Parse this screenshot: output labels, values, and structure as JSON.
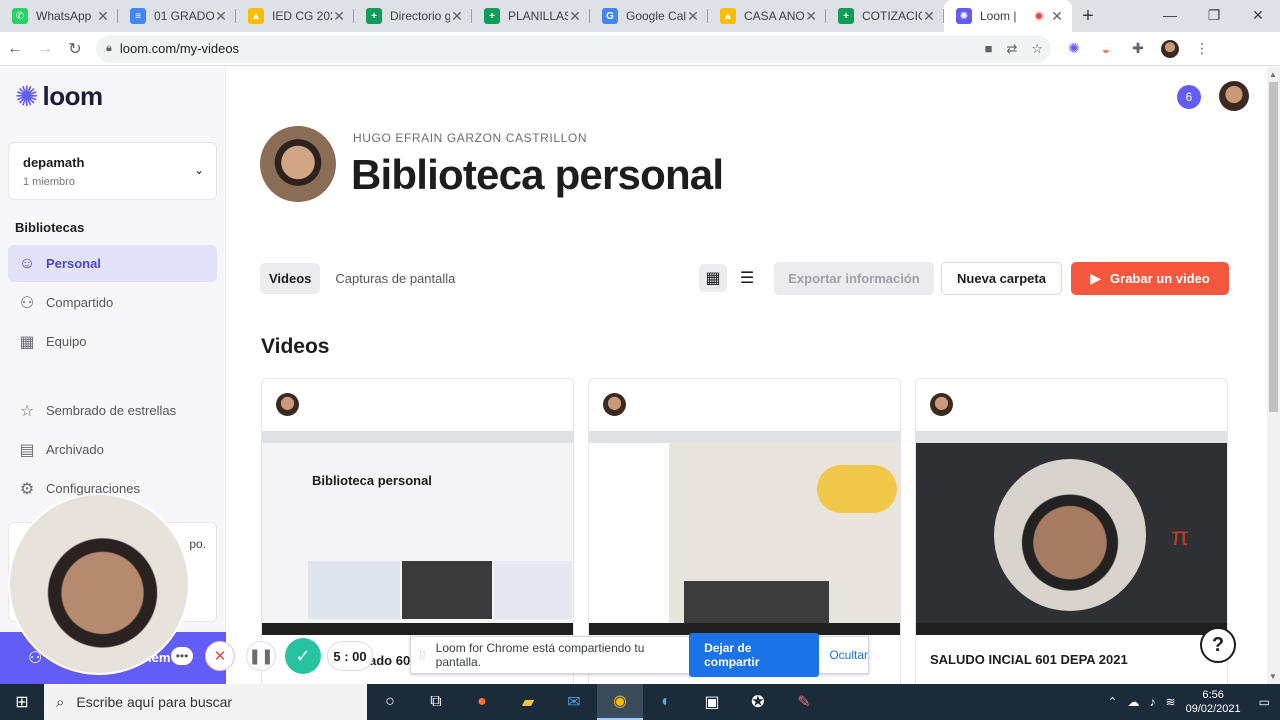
{
  "browser": {
    "tabs": [
      {
        "title": "WhatsApp",
        "color": "#25d366",
        "glyph": "✆"
      },
      {
        "title": "01 GRADO",
        "color": "#4285f4",
        "glyph": "≡"
      },
      {
        "title": "IED CG 202",
        "color": "#fbbc04",
        "glyph": "▲"
      },
      {
        "title": "Directorio g",
        "color": "#0f9d58",
        "glyph": "+"
      },
      {
        "title": "PLANILLAS",
        "color": "#0f9d58",
        "glyph": "+"
      },
      {
        "title": "Google Cal",
        "color": "#4285f4",
        "glyph": "G"
      },
      {
        "title": "CASA ANO",
        "color": "#fbbc04",
        "glyph": "▲"
      },
      {
        "title": "COTIZACIO",
        "color": "#0f9d58",
        "glyph": "+"
      }
    ],
    "active_tab": {
      "title": "Loom |",
      "color": "#625df5",
      "glyph": "✺"
    },
    "url": "loom.com/my-videos"
  },
  "sidebar": {
    "logo": "loom",
    "workspace": {
      "name": "depamath",
      "members": "1 miembro"
    },
    "section_title": "Bibliotecas",
    "items": [
      {
        "label": "Personal",
        "icon": "person-icon",
        "glyph": "☺"
      },
      {
        "label": "Compartido",
        "icon": "people-icon",
        "glyph": "⚇"
      },
      {
        "label": "Equipo",
        "icon": "building-icon",
        "glyph": "▦"
      },
      {
        "label": "Sembrado de estrellas",
        "icon": "star-icon",
        "glyph": "☆"
      },
      {
        "label": "Archivado",
        "icon": "archive-icon",
        "glyph": "▤"
      },
      {
        "label": "Configuraciones",
        "icon": "gear-icon",
        "glyph": "⚙"
      }
    ],
    "promo_text": "po."
  },
  "header": {
    "notification_count": "6",
    "owner_name": "HUGO EFRAIN GARZON CASTRILLON",
    "title": "Biblioteca personal"
  },
  "toolbar": {
    "tab_videos": "Videos",
    "tab_screenshots": "Capturas de pantalla",
    "export_label": "Exportar información",
    "new_folder_label": "Nueva carpeta",
    "record_label": "Grabar un video"
  },
  "videos": {
    "section_title": "Videos",
    "items": [
      {
        "title": "Biblioteca personal",
        "thumb_bg": "#f4f4f6"
      },
      {
        "title": "",
        "thumb_bg": "#e9e4dc"
      },
      {
        "title": "SALUDO INCIAL 601 DEPA 2021",
        "thumb_bg": "#2f3033"
      }
    ],
    "partial_title": "ado 60"
  },
  "recording": {
    "timer": "5 : 00",
    "share_message": "Loom for Chrome está compartiendo tu pantalla.",
    "stop_sharing": "Dejar de compartir",
    "hide": "Ocultar",
    "sidebar_bottom_text": "iem"
  },
  "taskbar": {
    "search_placeholder": "Escribe aquí para buscar",
    "time": "6:56",
    "date": "09/02/2021"
  }
}
